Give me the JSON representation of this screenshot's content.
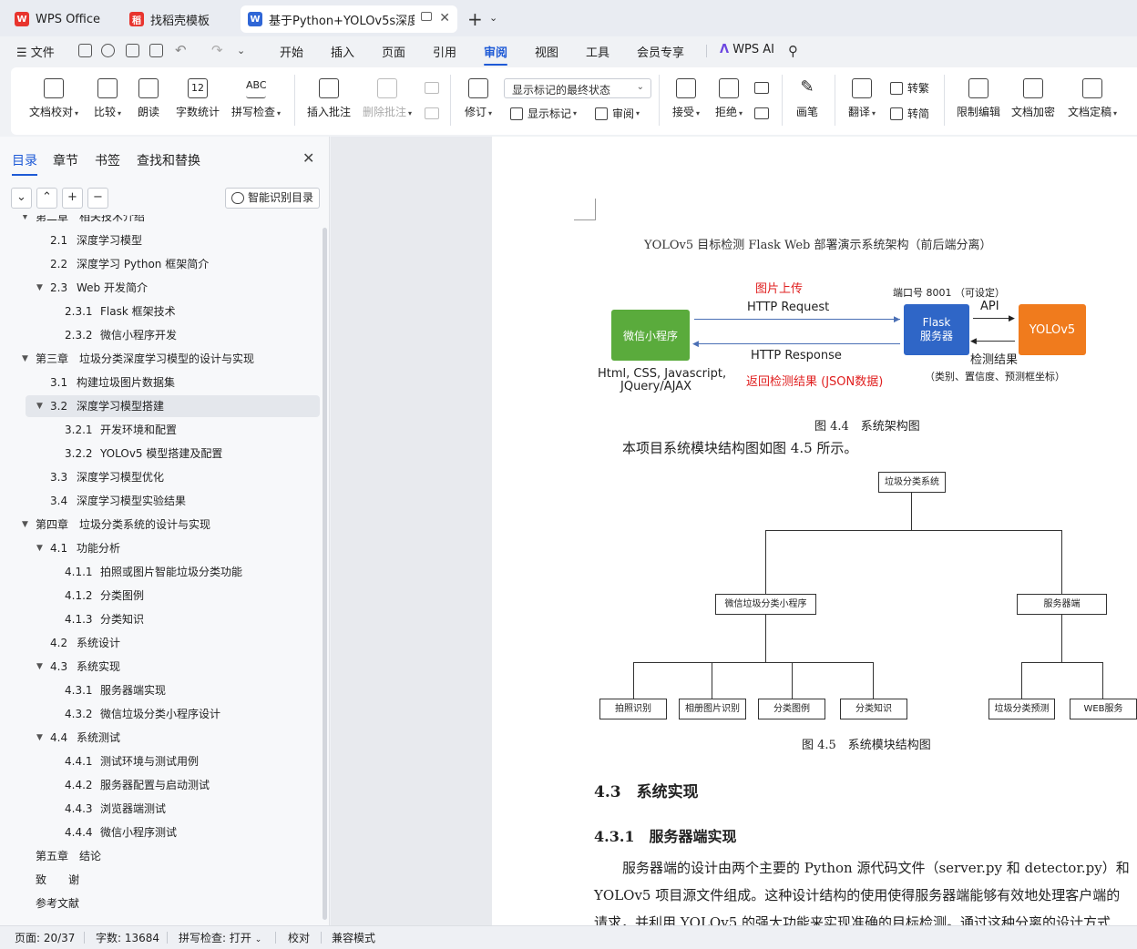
{
  "tabs": [
    {
      "label": "WPS Office",
      "icon": "wps-logo-icon"
    },
    {
      "label": "找稻壳模板",
      "icon": "docer-icon"
    },
    {
      "label": "基于Python+YOLOv5s深度学",
      "icon": "word-doc-icon"
    }
  ],
  "new_tab_symbol": "+",
  "menu": {
    "file": "文件",
    "items": [
      "开始",
      "插入",
      "页面",
      "引用",
      "审阅",
      "视图",
      "工具",
      "会员专享"
    ],
    "active": "审阅",
    "ai": "WPS AI"
  },
  "ribbon": {
    "doc_proof": "文档校对",
    "compare": "比较",
    "read_aloud": "朗读",
    "word_count": "字数统计",
    "word_count_icon_text": "12",
    "spell_check": "拼写检查",
    "spell_icon_text": "ABC",
    "insert_comment": "插入批注",
    "delete_comment": "删除批注",
    "revise": "修订",
    "markup_state": "显示标记的最终状态",
    "show_markup": "显示标记",
    "review": "审阅",
    "accept": "接受",
    "reject": "拒绝",
    "pen": "画笔",
    "translate": "翻译",
    "to_traditional": "转繁",
    "to_simplified": "转简",
    "restrict_edit": "限制编辑",
    "encrypt": "文档加密",
    "finalize": "文档定稿"
  },
  "nav": {
    "tabs": [
      "目录",
      "章节",
      "书签",
      "查找和替换"
    ],
    "smart_toc": "智能识别目录",
    "buttons": [
      "⌄",
      "⌃",
      "+",
      "−"
    ],
    "toc": [
      {
        "num": "第二章",
        "title": "相关技术介绍",
        "level": 1,
        "arrow": "expanded"
      },
      {
        "num": "2.1",
        "title": "深度学习模型",
        "level": 2,
        "arrow": "none"
      },
      {
        "num": "2.2",
        "title": "深度学习 Python 框架简介",
        "level": 2,
        "arrow": "none"
      },
      {
        "num": "2.3",
        "title": "Web 开发简介",
        "level": 2,
        "arrow": "expanded"
      },
      {
        "num": "2.3.1",
        "title": "Flask 框架技术",
        "level": 3,
        "arrow": "none"
      },
      {
        "num": "2.3.2",
        "title": "微信小程序开发",
        "level": 3,
        "arrow": "none"
      },
      {
        "num": "第三章",
        "title": "垃圾分类深度学习模型的设计与实现",
        "level": 1,
        "arrow": "expanded"
      },
      {
        "num": "3.1",
        "title": "构建垃圾图片数据集",
        "level": 2,
        "arrow": "none"
      },
      {
        "num": "3.2",
        "title": "深度学习模型搭建",
        "level": 2,
        "arrow": "expanded",
        "selected": true
      },
      {
        "num": "3.2.1",
        "title": "开发环境和配置",
        "level": 3,
        "arrow": "none"
      },
      {
        "num": "3.2.2",
        "title": "YOLOv5 模型搭建及配置",
        "level": 3,
        "arrow": "none"
      },
      {
        "num": "3.3",
        "title": "深度学习模型优化",
        "level": 2,
        "arrow": "none"
      },
      {
        "num": "3.4",
        "title": "深度学习模型实验结果",
        "level": 2,
        "arrow": "none"
      },
      {
        "num": "第四章",
        "title": "垃圾分类系统的设计与实现",
        "level": 1,
        "arrow": "expanded"
      },
      {
        "num": "4.1",
        "title": "功能分析",
        "level": 2,
        "arrow": "expanded"
      },
      {
        "num": "4.1.1",
        "title": "拍照或图片智能垃圾分类功能",
        "level": 3,
        "arrow": "none"
      },
      {
        "num": "4.1.2",
        "title": "分类图例",
        "level": 3,
        "arrow": "none"
      },
      {
        "num": "4.1.3",
        "title": "分类知识",
        "level": 3,
        "arrow": "none"
      },
      {
        "num": "4.2",
        "title": "系统设计",
        "level": 2,
        "arrow": "none"
      },
      {
        "num": "4.3",
        "title": "系统实现",
        "level": 2,
        "arrow": "expanded"
      },
      {
        "num": "4.3.1",
        "title": "服务器端实现",
        "level": 3,
        "arrow": "none"
      },
      {
        "num": "4.3.2",
        "title": "微信垃圾分类小程序设计",
        "level": 3,
        "arrow": "none"
      },
      {
        "num": "4.4",
        "title": "系统测试",
        "level": 2,
        "arrow": "expanded"
      },
      {
        "num": "4.4.1",
        "title": "测试环境与测试用例",
        "level": 3,
        "arrow": "none"
      },
      {
        "num": "4.4.2",
        "title": "服务器配置与启动测试",
        "level": 3,
        "arrow": "none"
      },
      {
        "num": "4.4.3",
        "title": "浏览器端测试",
        "level": 3,
        "arrow": "none"
      },
      {
        "num": "4.4.4",
        "title": "微信小程序测试",
        "level": 3,
        "arrow": "none"
      },
      {
        "num": "第五章",
        "title": "结论",
        "level": 1,
        "arrow": "none"
      },
      {
        "num": "致",
        "title": "谢",
        "level": 1,
        "arrow": "none"
      },
      {
        "num": "",
        "title": "参考文献",
        "level": 1,
        "arrow": "none"
      }
    ]
  },
  "document": {
    "arch_title": "YOLOv5 目标检测 Flask Web 部署演示系统架构（前后端分离）",
    "arch": {
      "mini_program": "微信小程序",
      "flask": "Flask\n服务器",
      "yolo": "YOLOv5",
      "upload": "图片上传",
      "http_request": "HTTP Request",
      "http_response": "HTTP Response",
      "return_result": "返回检测结果 (JSON数据)",
      "port": "端口号 8001 （可设定）",
      "api": "API",
      "detect_result": "检测结果",
      "detect_detail": "（类别、置信度、预测框坐标）",
      "frontend_tech_1": "Html, CSS, Javascript,",
      "frontend_tech_2": "JQuery/AJAX"
    },
    "fig44_caption": "图 4.4　系统架构图",
    "intro_line": "本项目系统模块结构图如图 4.5 所示。",
    "org": {
      "root": "垃圾分类系统",
      "left": "微信垃圾分类小程序",
      "right": "服务器端",
      "left_children": [
        "拍照识别",
        "相册图片识别",
        "分类图例",
        "分类知识"
      ],
      "right_children": [
        "垃圾分类预测",
        "WEB服务"
      ]
    },
    "fig45_caption": "图 4.5　系统模块结构图",
    "h2": "4.3　系统实现",
    "h3": "4.3.1　服务器端实现",
    "para_lines": [
      "服务器端的设计由两个主要的 Python 源代码文件（server.py 和 detector.py）和",
      "YOLOv5 项目源文件组成。这种设计结构的使用使得服务器端能够有效地处理客户端的",
      "请求，并利用 YOLOv5 的强大功能来实现准确的目标检测。通过这种分离的设计方式"
    ]
  },
  "status": {
    "page": "页面: 20/37",
    "words": "字数: 13684",
    "spell": "拼写检查: 打开",
    "proof": "校对",
    "compat": "兼容模式"
  },
  "colors": {
    "accent": "#1e5ad6",
    "green_box": "#5aab3c",
    "blue_box": "#2f66c7",
    "orange_box": "#f07b1d",
    "red_text": "#e02020"
  }
}
